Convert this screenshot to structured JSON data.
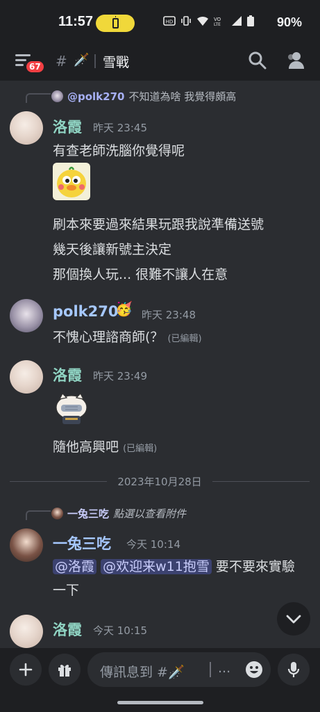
{
  "status_bar": {
    "time": "11:57",
    "battery_pct": "90%"
  },
  "header": {
    "badge_count": "67",
    "channel_emoji": "🗡️",
    "channel_name": "雪戰"
  },
  "messages": [
    {
      "reply": {
        "name": "@polk270",
        "text": "不知道為啥 我覺得頗高"
      },
      "author": "洛霞",
      "timestamp": "昨天 23:45",
      "lines": [
        "有查老師洗腦你覺得呢",
        "刷本來要過來結果玩跟我說準備送號",
        "幾天後讓新號主決定",
        "那個換人玩... 很難不讓人在意"
      ]
    },
    {
      "author": "polk270",
      "role_emoji": "🥳",
      "timestamp": "昨天 23:48",
      "lines": [
        "不愧心理諮商師(？"
      ],
      "edited": "(已編輯)"
    },
    {
      "author": "洛霞",
      "timestamp": "昨天 23:49",
      "lines": [
        "隨他高興吧"
      ],
      "edited": "(已編輯)"
    },
    {
      "reply": {
        "name": "一兔三吃",
        "text": "點選以查看附件"
      },
      "author": "一兔三吃",
      "timestamp": "今天 10:14",
      "mentions": [
        "@洛霞",
        "@欢迎来w11抱雪"
      ],
      "after_mentions": " 要不要來實驗",
      "lines": [
        "一下"
      ]
    },
    {
      "author": "洛霞",
      "timestamp": "今天 10:15"
    }
  ],
  "date_divider": "2023年10月28日",
  "composer": {
    "placeholder": "傳訊息到 #🗡️",
    "more": "..."
  }
}
